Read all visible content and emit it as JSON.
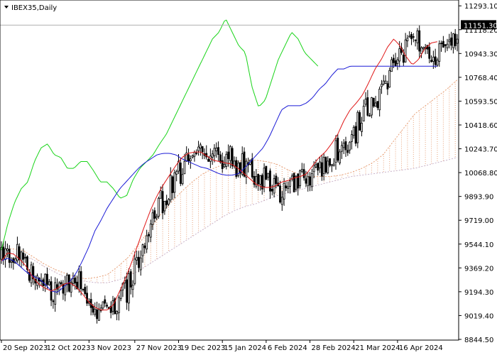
{
  "chart_data": {
    "type": "candlestick",
    "title": "IBEX35,Daily",
    "current_price": 11151.3,
    "ylim": [
      8839.2,
      11336.0
    ],
    "y_ticks": [
      "11293.10",
      "11118.20",
      "10943.30",
      "10768.40",
      "10593.50",
      "10418.60",
      "10243.70",
      "10068.80",
      "9893.90",
      "9719.00",
      "9544.10",
      "9369.20",
      "9194.30",
      "9019.40",
      "8844.50"
    ],
    "x_ticks": [
      "20 Sep 2023",
      "12 Oct 2023",
      "3 Nov 2023",
      "27 Nov 2023",
      "19 Dec 2023",
      "15 Jan 2024",
      "6 Feb 2024",
      "28 Feb 2024",
      "21 Mar 2024",
      "16 Apr 2024"
    ],
    "tenkan_sen": [
      9420,
      9480,
      9470,
      9430,
      9380,
      9300,
      9250,
      9220,
      9200,
      9220,
      9250,
      9260,
      9230,
      9180,
      9120,
      9080,
      9060,
      9060,
      9100,
      9200,
      9300,
      9420,
      9550,
      9680,
      9800,
      9900,
      9980,
      10050,
      10120,
      10180,
      10210,
      10220,
      10220,
      10190,
      10160,
      10150,
      10140,
      10130,
      10100,
      10060,
      10020,
      9980,
      9960,
      9960,
      9970,
      10000,
      10010,
      10030,
      10040,
      10060,
      10120,
      10180,
      10220,
      10280,
      10350,
      10450,
      10530,
      10580,
      10640,
      10730,
      10830,
      10900,
      10990,
      11050,
      11000,
      10920,
      10860,
      10900,
      10980,
      11020,
      11030
    ],
    "kijun_sen": [
      9420,
      9440,
      9420,
      9380,
      9340,
      9310,
      9290,
      9250,
      9200,
      9190,
      9230,
      9270,
      9330,
      9420,
      9520,
      9640,
      9720,
      9810,
      9880,
      9950,
      10000,
      10050,
      10100,
      10140,
      10170,
      10200,
      10210,
      10210,
      10200,
      10170,
      10150,
      10130,
      10110,
      10100,
      10080,
      10060,
      10050,
      10050,
      10060,
      10100,
      10150,
      10200,
      10250,
      10330,
      10430,
      10530,
      10560,
      10560,
      10560,
      10580,
      10620,
      10680,
      10720,
      10780,
      10830,
      10830,
      10850,
      10850,
      10850,
      10850,
      10850,
      10850,
      10850,
      10850,
      10850,
      10850,
      10850,
      10850,
      10850,
      10850,
      10850
    ],
    "chikou_span": [
      9500,
      9700,
      9850,
      9950,
      10000,
      10150,
      10250,
      10280,
      10200,
      10180,
      10100,
      10100,
      10150,
      10150,
      10080,
      10000,
      10000,
      9950,
      9880,
      9900,
      10020,
      10100,
      10150,
      10200,
      10280,
      10350,
      10450,
      10550,
      10650,
      10750,
      10850,
      10950,
      11050,
      11100,
      11200,
      11100,
      11000,
      10950,
      10700,
      10550,
      10600,
      10750,
      10900,
      11000,
      11100,
      11050,
      10950,
      10900,
      10850
    ],
    "senkou_a": [
      9500,
      9510,
      9500,
      9450,
      9400,
      9360,
      9330,
      9300,
      9290,
      9300,
      9320,
      9380,
      9450,
      9550,
      9650,
      9760,
      9850,
      9930,
      10000,
      10060,
      10100,
      10130,
      10150,
      10160,
      10160,
      10150,
      10130,
      10090,
      10060,
      10040,
      10040,
      10040,
      10050,
      10070,
      10100,
      10140,
      10200,
      10300,
      10400,
      10500,
      10560,
      10620,
      10680,
      10750
    ],
    "senkou_b": [
      9480,
      9480,
      9460,
      9430,
      9380,
      9340,
      9300,
      9280,
      9270,
      9260,
      9260,
      9280,
      9310,
      9350,
      9400,
      9450,
      9500,
      9550,
      9600,
      9650,
      9700,
      9750,
      9790,
      9820,
      9840,
      9870,
      9900,
      9920,
      9940,
      9960,
      9980,
      10000,
      10020,
      10040,
      10050,
      10060,
      10070,
      10080,
      10090,
      10100,
      10120,
      10140,
      10160,
      10180
    ]
  }
}
